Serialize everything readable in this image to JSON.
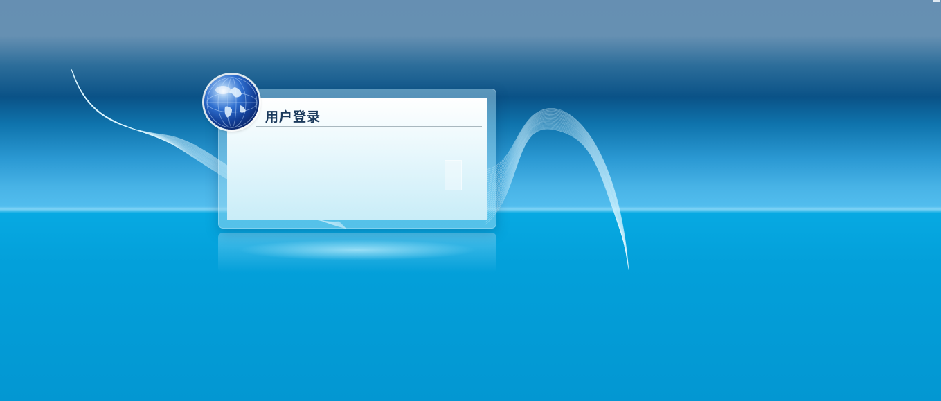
{
  "login": {
    "title": "用户登录"
  },
  "icons": {
    "globe": "globe-icon"
  },
  "colors": {
    "title_text": "#1b3a5c",
    "sky_top": "#668fb2",
    "sky_band": "#0a5287",
    "horizon": "#52bdee",
    "floor": "#0397d2"
  }
}
